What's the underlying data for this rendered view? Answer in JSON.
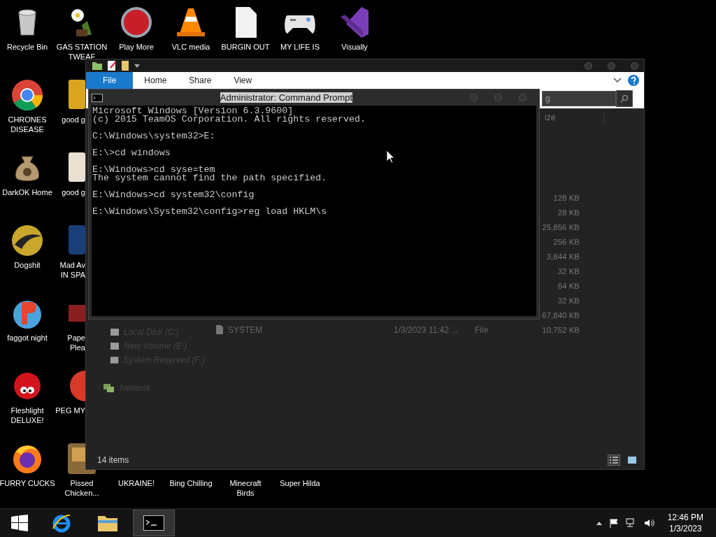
{
  "desktop": {
    "columns": [
      [
        {
          "label": "Recycle Bin"
        },
        {
          "label": "CHRONES\nDISEASE"
        },
        {
          "label": "DarkOK Home"
        },
        {
          "label": "Dogshit"
        },
        {
          "label": "faggot night"
        },
        {
          "label": "Fleshlight\nDELUXE!"
        },
        {
          "label": "FURRY CUCKS"
        }
      ],
      [
        {
          "label": "GAS STATION\nTWEAF",
          "kind": "full"
        },
        {
          "label": "good g",
          "kind": "cut"
        },
        {
          "label": "good g",
          "kind": "cut"
        },
        {
          "label": "Mad Av\nIN SPA",
          "kind": "cut"
        },
        {
          "label": "Pape\nPlea",
          "kind": "cut"
        },
        {
          "label": "PEG MY",
          "kind": "cut"
        },
        {
          "label": "Pissed\nChicken...",
          "kind": "full"
        }
      ],
      [
        {
          "label": "Play More"
        },
        {
          "label": "UKRAINE!"
        }
      ],
      [
        {
          "label": "VLC media"
        },
        {
          "label": "Bing Chilling"
        }
      ],
      [
        {
          "label": "BURGIN OUT"
        },
        {
          "label": "Minecraft\nBirds"
        }
      ],
      [
        {
          "label": "MY LIFE IS"
        },
        {
          "label": "Super Hilda"
        }
      ],
      [
        {
          "label": "Visually"
        }
      ]
    ]
  },
  "explorer": {
    "ribbon_tabs": [
      {
        "label": "File",
        "kind": "menu"
      },
      {
        "label": "Home",
        "kind": "tab"
      },
      {
        "label": "Share",
        "kind": "tab"
      },
      {
        "label": "View",
        "kind": "tab"
      }
    ],
    "search": {
      "value": "g"
    },
    "column_header": "ize",
    "files": [
      {
        "size": "128 KB"
      },
      {
        "size": "28 KB"
      },
      {
        "size": "25,856 KB"
      },
      {
        "size": "256 KB"
      },
      {
        "size": "3,844 KB"
      },
      {
        "size": "32 KB"
      },
      {
        "size": "64 KB"
      },
      {
        "size": "32 KB"
      },
      {
        "size": "67,840 KB"
      },
      {
        "name": "SYSTEM",
        "date": "1/3/2023 11:42 ...",
        "type": "File",
        "size": "10,752 KB"
      }
    ],
    "nav": [
      {
        "label": "Local Disk (C:)",
        "kind": "drive"
      },
      {
        "label": "New Volume (E:)",
        "kind": "drive"
      },
      {
        "label": "System Reserved (F:)",
        "kind": "drive"
      },
      {
        "label": "Network",
        "kind": "network"
      }
    ],
    "status_bar": {
      "items": "14 items",
      "views": [
        {
          "selected": true
        },
        {
          "selected": false
        }
      ]
    }
  },
  "cmd": {
    "title": "Administrator: Command Prompt",
    "title_highlighted": true,
    "blocks": [
      [
        "Microsoft Windows [Version 6.3.9600]",
        "(c) 2015 TeamOS Corporation. All rights reserved."
      ],
      [
        "C:\\Windows\\system32>E:"
      ],
      [
        "E:\\>cd windows"
      ],
      [
        "E:\\Windows>cd syse=tem",
        "The system cannot find the path specified."
      ],
      [
        "E:\\Windows>cd system32\\config"
      ],
      [
        "E:\\Windows\\System32\\config>reg load HKLM\\s"
      ]
    ]
  },
  "taskbar": {
    "apps": [
      {
        "selected": false
      },
      {
        "selected": false
      },
      {
        "selected": true
      }
    ],
    "time": "12:46 PM",
    "date": "1/3/2023"
  }
}
